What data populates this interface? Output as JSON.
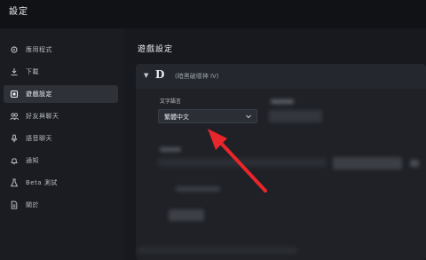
{
  "window": {
    "title": "設定"
  },
  "sidebar": {
    "items": [
      {
        "label": "應用程式",
        "icon": "gear-icon",
        "active": false
      },
      {
        "label": "下載",
        "icon": "download-icon",
        "active": false
      },
      {
        "label": "遊戲設定",
        "icon": "gamepad-icon",
        "active": true
      },
      {
        "label": "好友與聊天",
        "icon": "friends-icon",
        "active": false
      },
      {
        "label": "語音聊天",
        "icon": "microphone-icon",
        "active": false
      },
      {
        "label": "通知",
        "icon": "bell-icon",
        "active": false
      },
      {
        "label": "Beta 測試",
        "icon": "flask-icon",
        "active": false
      },
      {
        "label": "關於",
        "icon": "document-icon",
        "active": false
      }
    ]
  },
  "main": {
    "title": "遊戲設定",
    "game": {
      "logo": "D",
      "name": "(暗黑破壞神 IV)"
    },
    "language": {
      "label": "文字語言",
      "value": "繁體中文"
    }
  },
  "colors": {
    "annotation_arrow": "#e8262b",
    "active_bg": "#2e3138"
  }
}
